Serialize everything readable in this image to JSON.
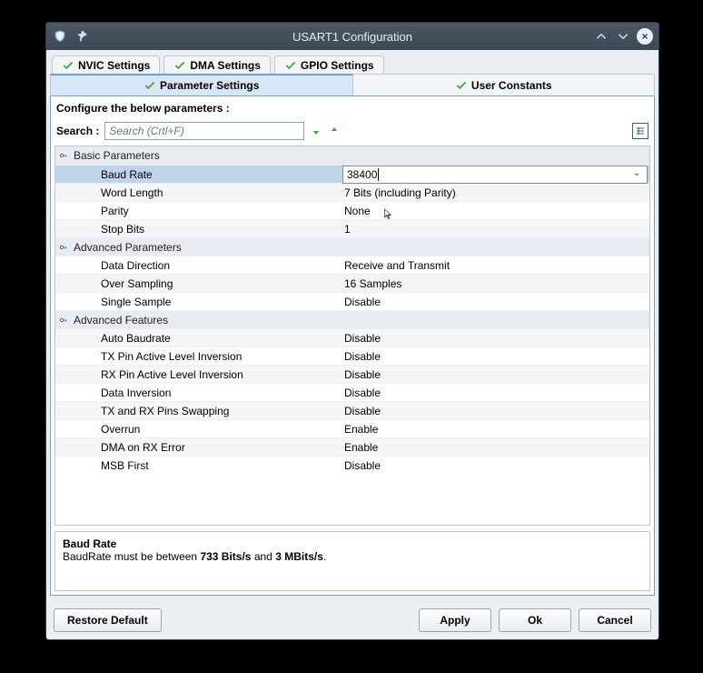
{
  "window": {
    "title": "USART1 Configuration"
  },
  "tabs_outer": [
    {
      "label": "NVIC Settings"
    },
    {
      "label": "DMA Settings"
    },
    {
      "label": "GPIO Settings"
    }
  ],
  "tabs_inner": [
    {
      "label": "Parameter Settings",
      "active": true
    },
    {
      "label": "User Constants",
      "active": false
    }
  ],
  "config_header": "Configure the below parameters :",
  "search": {
    "label": "Search :",
    "placeholder": "Search (Crtl+F)"
  },
  "groups": [
    {
      "title": "Basic Parameters",
      "rows": [
        {
          "label": "Baud Rate",
          "value": "38400",
          "selected": true,
          "editable": true
        },
        {
          "label": "Word Length",
          "value": "7 Bits (including Parity)"
        },
        {
          "label": "Parity",
          "value": "None"
        },
        {
          "label": "Stop Bits",
          "value": "1"
        }
      ]
    },
    {
      "title": "Advanced Parameters",
      "rows": [
        {
          "label": "Data Direction",
          "value": "Receive and Transmit"
        },
        {
          "label": "Over Sampling",
          "value": "16 Samples"
        },
        {
          "label": "Single Sample",
          "value": "Disable"
        }
      ]
    },
    {
      "title": "Advanced Features",
      "rows": [
        {
          "label": "Auto Baudrate",
          "value": "Disable"
        },
        {
          "label": "TX Pin Active Level Inversion",
          "value": "Disable"
        },
        {
          "label": "RX Pin Active Level Inversion",
          "value": "Disable"
        },
        {
          "label": "Data Inversion",
          "value": "Disable"
        },
        {
          "label": "TX and RX Pins Swapping",
          "value": "Disable"
        },
        {
          "label": "Overrun",
          "value": "Enable"
        },
        {
          "label": "DMA on RX Error",
          "value": "Enable"
        },
        {
          "label": "MSB First",
          "value": "Disable"
        }
      ]
    }
  ],
  "description": {
    "title": "Baud Rate",
    "pre": "BaudRate must be between ",
    "bold1": "733 Bits/s",
    "mid": " and ",
    "bold2": "3 MBits/s",
    "post": "."
  },
  "buttons": {
    "restore": "Restore Default",
    "apply": "Apply",
    "ok": "Ok",
    "cancel": "Cancel"
  }
}
